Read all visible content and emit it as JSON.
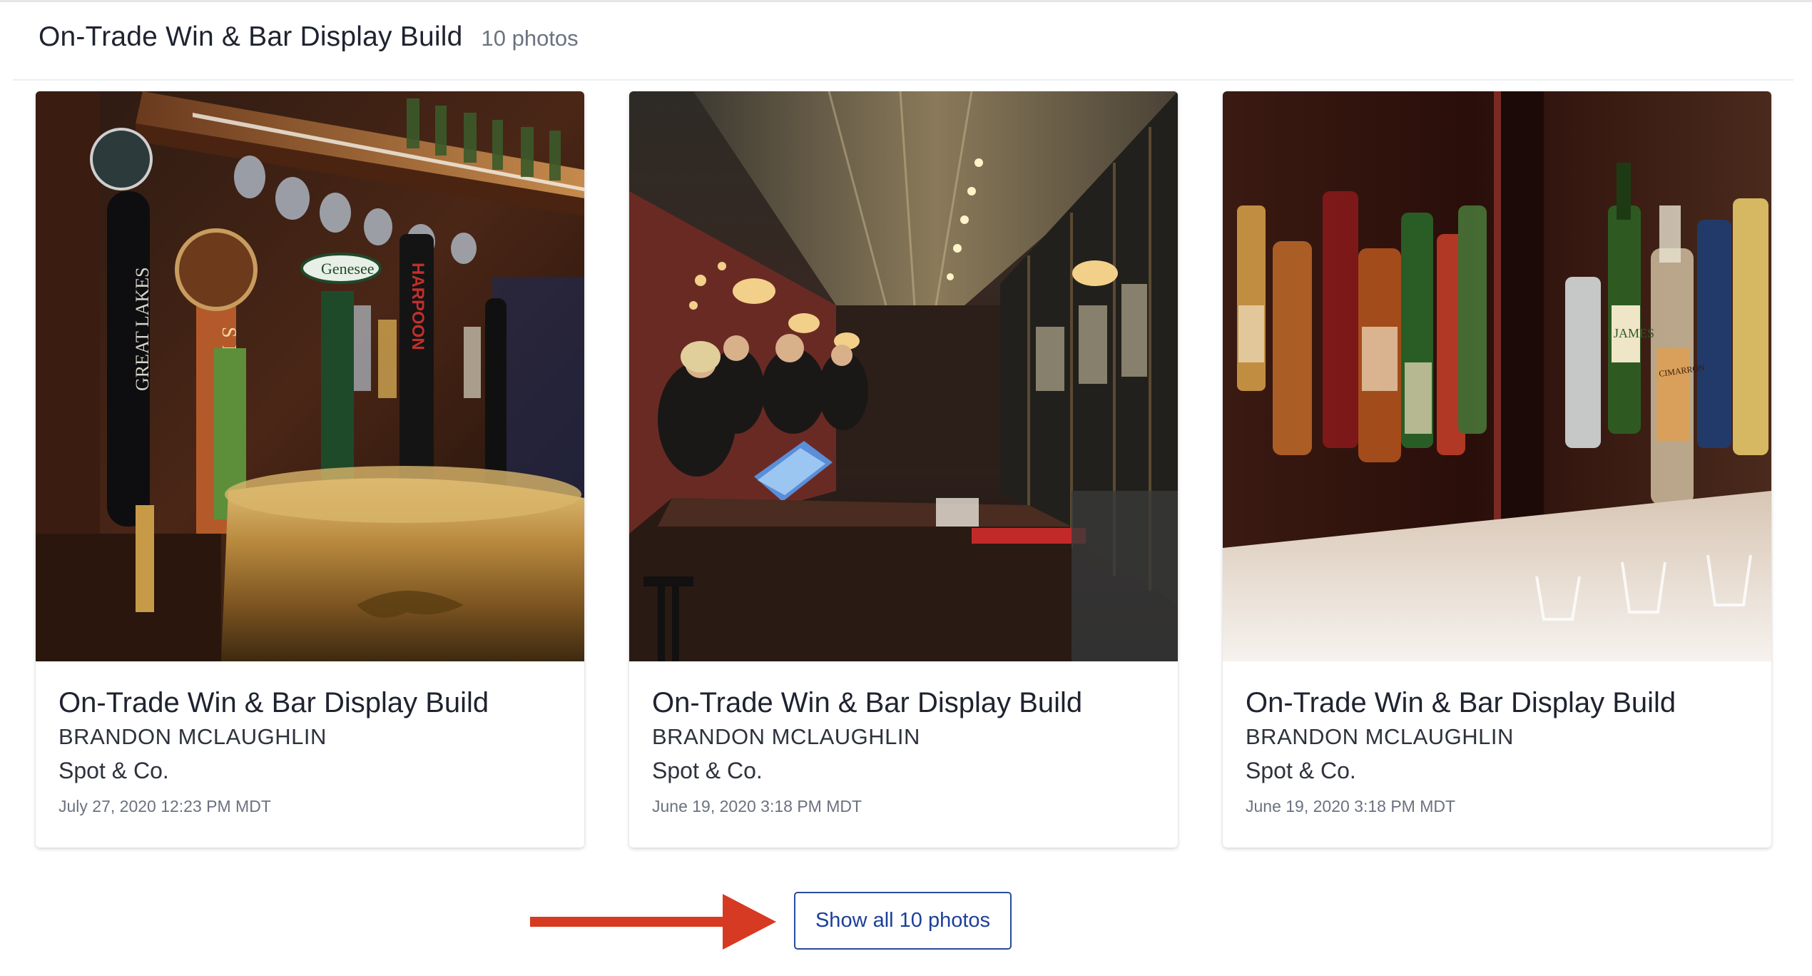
{
  "album": {
    "title": "On-Trade Win & Bar Display Build",
    "count_label": "10 photos"
  },
  "cards": [
    {
      "title": "On-Trade Win & Bar Display Build",
      "author": "BRANDON MCLAUGHLIN",
      "org": "Spot & Co.",
      "date": "July 27, 2020 12:23 PM MDT",
      "photo": "beer-taps-photo",
      "tap_labels": [
        "GREAT LAKES",
        "SIERRA",
        "Genesee",
        "HARPOON"
      ]
    },
    {
      "title": "On-Trade Win & Bar Display Build",
      "author": "BRANDON MCLAUGHLIN",
      "org": "Spot & Co.",
      "date": "June 19, 2020 3:18 PM MDT",
      "photo": "bar-interior-photo"
    },
    {
      "title": "On-Trade Win & Bar Display Build",
      "author": "BRANDON MCLAUGHLIN",
      "org": "Spot & Co.",
      "date": "June 19, 2020 3:18 PM MDT",
      "photo": "liquor-bottles-photo",
      "bottle_labels": [
        "JAMES",
        "CIMARRON"
      ]
    }
  ],
  "actions": {
    "show_all_label": "Show all 10 photos"
  },
  "colors": {
    "accent": "#1c3f9a",
    "arrow": "#d63a22",
    "text": "#1f2330",
    "muted": "#6b7280"
  }
}
